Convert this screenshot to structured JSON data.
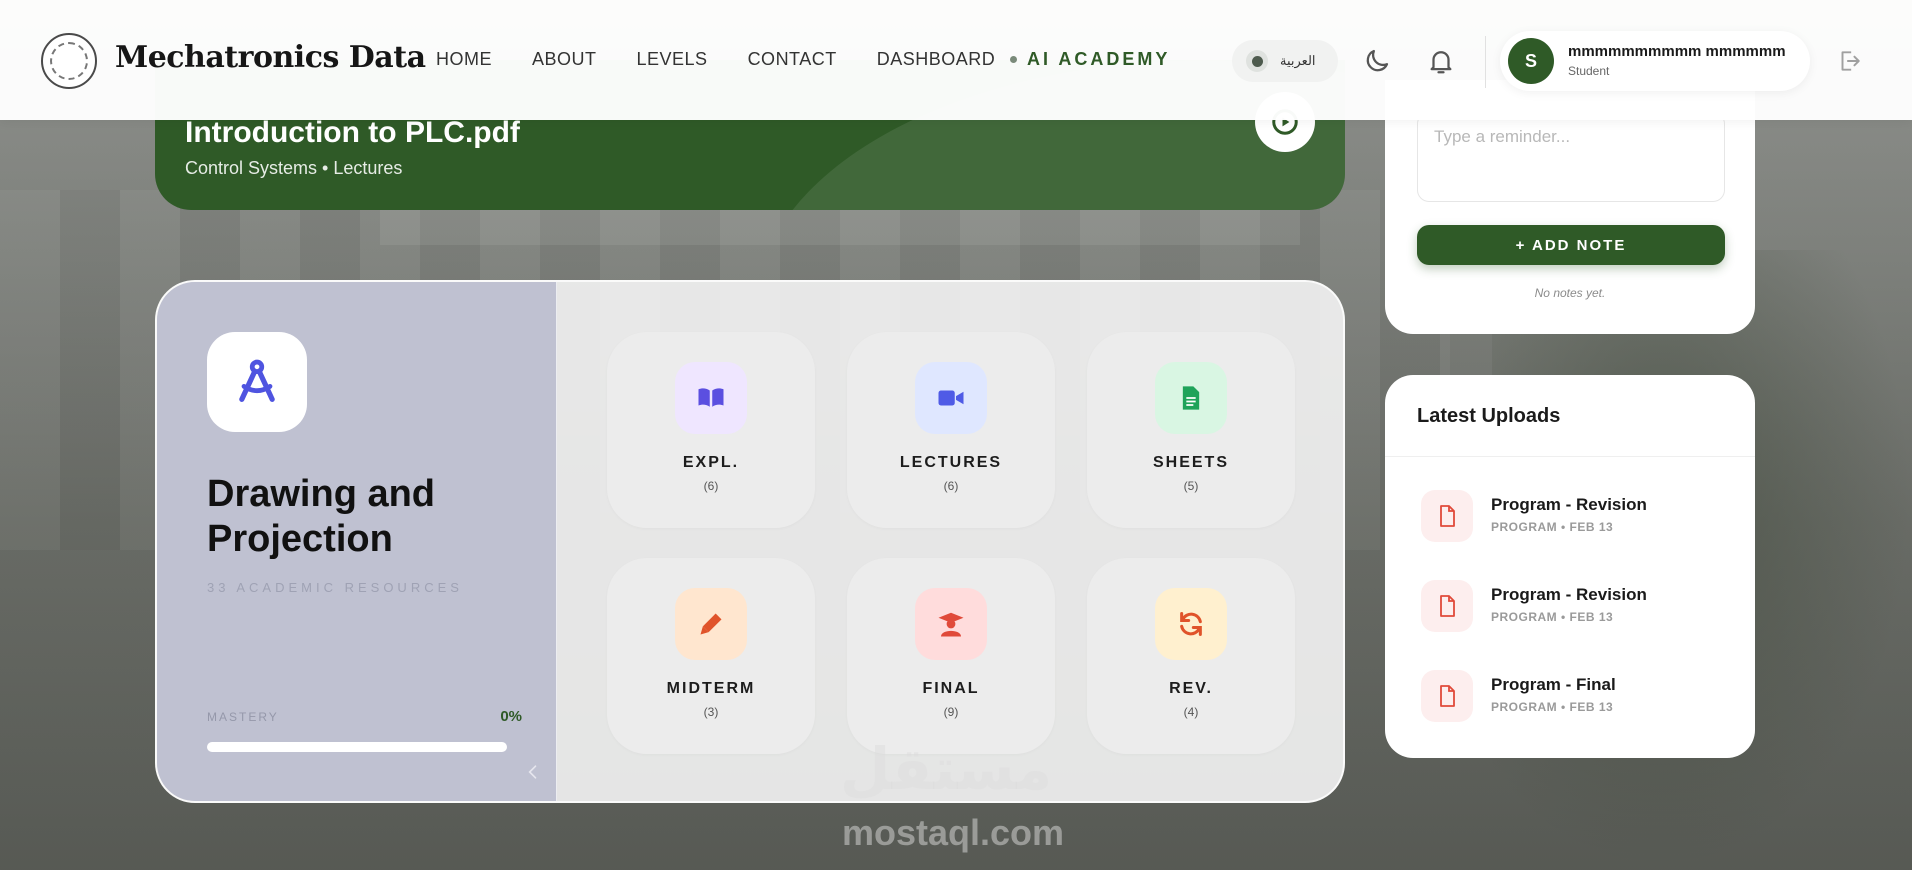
{
  "header": {
    "brand": "Mechatronics Data",
    "nav": [
      "HOME",
      "ABOUT",
      "LEVELS",
      "CONTACT",
      "DASHBOARD"
    ],
    "ai_academy": "AI ACADEMY",
    "language": "العربية",
    "user": {
      "initial": "S",
      "name": "mmmmmmmmmm mmmmmm",
      "role": "Student"
    }
  },
  "banner": {
    "file_title": "Introduction to PLC.pdf",
    "subtitle": "Control Systems • Lectures"
  },
  "subject": {
    "title": "Drawing and Projection",
    "resources": "33 ACADEMIC RESOURCES",
    "mastery_label": "MASTERY",
    "mastery_value": "0%",
    "mastery_fraction": 0,
    "tiles": [
      {
        "label": "EXPL.",
        "count": "(6)",
        "icon": "book-icon",
        "bg": "#efe6ff",
        "fg": "#5b4fe0"
      },
      {
        "label": "LECTURES",
        "count": "(6)",
        "icon": "video-icon",
        "bg": "#dfe7ff",
        "fg": "#4f5be6"
      },
      {
        "label": "SHEETS",
        "count": "(5)",
        "icon": "sheet-icon",
        "bg": "#d9f6e3",
        "fg": "#1fa35a"
      },
      {
        "label": "MIDTERM",
        "count": "(3)",
        "icon": "pen-icon",
        "bg": "#ffe6cf",
        "fg": "#e0532a"
      },
      {
        "label": "FINAL",
        "count": "(9)",
        "icon": "graduate-icon",
        "bg": "#ffdcdc",
        "fg": "#e04a3a"
      },
      {
        "label": "REV.",
        "count": "(4)",
        "icon": "refresh-icon",
        "bg": "#fff0cf",
        "fg": "#e0532a"
      }
    ]
  },
  "notes": {
    "placeholder": "Type a reminder...",
    "add_label": "+ ADD NOTE",
    "empty": "No notes yet."
  },
  "uploads": {
    "title": "Latest Uploads",
    "items": [
      {
        "title": "Program - Revision",
        "type": "PROGRAM",
        "date": "FEB 13"
      },
      {
        "title": "Program - Revision",
        "type": "PROGRAM",
        "date": "FEB 13"
      },
      {
        "title": "Program - Final",
        "type": "PROGRAM",
        "date": "FEB 13"
      }
    ]
  },
  "watermark": {
    "arabic": "مستقل",
    "latin": "mostaql.com"
  },
  "colors": {
    "primary": "#2f5a27",
    "subject_panel": "#bfc1d1"
  }
}
